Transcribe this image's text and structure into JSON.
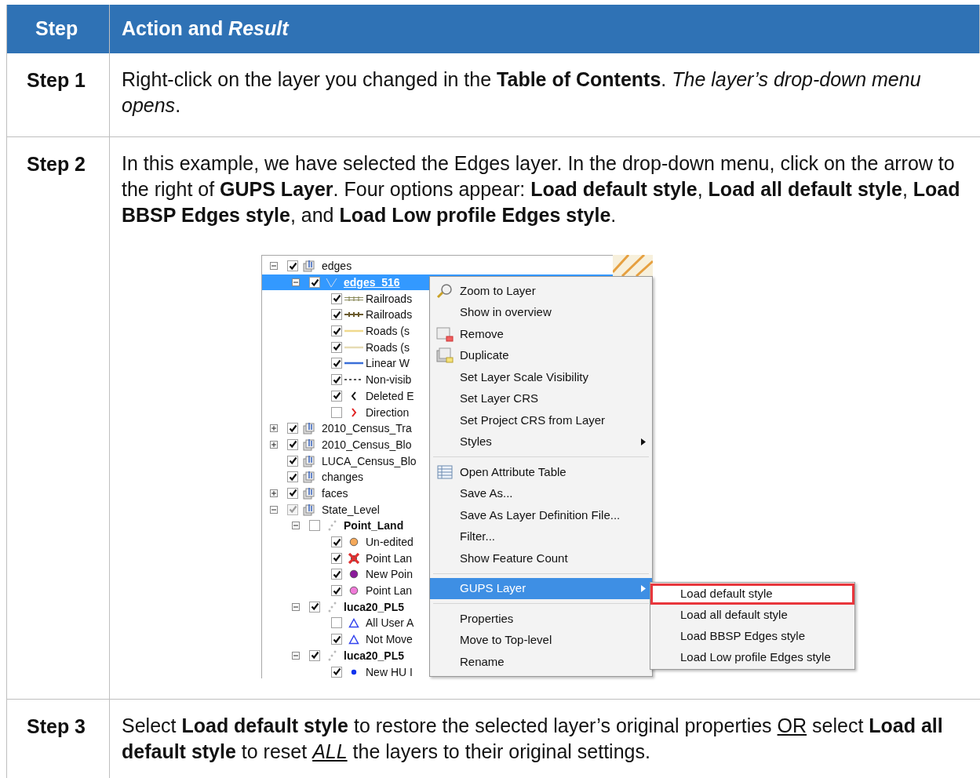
{
  "header": {
    "cells": [
      [
        {
          "text": "Step",
          "bold": true
        }
      ],
      [
        {
          "text": "Action and ",
          "bold": true
        },
        {
          "text": "Result",
          "bold": true,
          "italic": true
        }
      ]
    ]
  },
  "rows": [
    {
      "step": "Step 1",
      "text": [
        {
          "text": "Right-click on the layer you changed in the "
        },
        {
          "text": "Table of Contents",
          "bold": true
        },
        {
          "text": ". "
        },
        {
          "text": "The layer’s drop-down menu opens",
          "italic": true
        },
        {
          "text": "."
        }
      ]
    },
    {
      "step": "Step 2",
      "text": [
        {
          "text": "In this example, we have selected the Edges layer. In the drop-down menu, click on the arrow to the right of "
        },
        {
          "text": "GUPS Layer",
          "bold": true
        },
        {
          "text": ". Four options appear: "
        },
        {
          "text": "Load default style",
          "bold": true
        },
        {
          "text": ", "
        },
        {
          "text": "Load all default style",
          "bold": true
        },
        {
          "text": ", "
        },
        {
          "text": "Load BBSP Edges style",
          "bold": true
        },
        {
          "text": ", and "
        },
        {
          "text": "Load Low profile Edges style",
          "bold": true
        },
        {
          "text": "."
        }
      ],
      "screenshot": {
        "tree": [
          {
            "label": "edges",
            "kind": "group",
            "checked": true,
            "expanded": true,
            "selected": false,
            "children": [
              {
                "label": "edges_516",
                "kind": "line-layer",
                "checked": true,
                "expanded": true,
                "selected": true,
                "children": [
                  {
                    "label": "Railroads",
                    "kind": "double-line",
                    "color": "#8a8a5c",
                    "checked": true,
                    "selected": false
                  },
                  {
                    "label": "Railroads",
                    "kind": "tick-line",
                    "color": "#6b5b2e",
                    "checked": true,
                    "selected": false
                  },
                  {
                    "label": "Roads (s",
                    "kind": "line",
                    "color": "#f0d98c",
                    "checked": true,
                    "selected": false
                  },
                  {
                    "label": "Roads (s",
                    "kind": "line",
                    "color": "#e6dcb4",
                    "checked": true,
                    "selected": false
                  },
                  {
                    "label": "Linear W",
                    "kind": "line",
                    "color": "#3a6fd8",
                    "checked": true,
                    "selected": false
                  },
                  {
                    "label": "Non-visib",
                    "kind": "dashed",
                    "color": "#555555",
                    "checked": true,
                    "selected": false
                  },
                  {
                    "label": "Deleted E",
                    "kind": "chevron",
                    "color": "#111111",
                    "checked": true,
                    "selected": false
                  },
                  {
                    "label": "Direction",
                    "kind": "chevron",
                    "color": "#e02020",
                    "checked": false,
                    "selected": false
                  }
                ]
              }
            ]
          },
          {
            "label": "2010_Census_Tra",
            "kind": "group",
            "checked": true,
            "expanded": false,
            "selected": false
          },
          {
            "label": "2010_Census_Blo",
            "kind": "group",
            "checked": true,
            "expanded": false,
            "selected": false
          },
          {
            "label": "LUCA_Census_Blo",
            "kind": "group",
            "checked": true,
            "selected": false
          },
          {
            "label": "changes",
            "kind": "group",
            "checked": true,
            "selected": false
          },
          {
            "label": "faces",
            "kind": "group",
            "checked": true,
            "expanded": false,
            "selected": false
          },
          {
            "label": "State_Level",
            "kind": "group",
            "checked": true,
            "dimmed": true,
            "expanded": true,
            "selected": false,
            "children": [
              {
                "label": "Point_Land",
                "kind": "point-layer",
                "checked": false,
                "expanded": true,
                "bold": true,
                "selected": false,
                "children": [
                  {
                    "label": "Un-edited",
                    "kind": "circle",
                    "color": "#f5a95a",
                    "checked": true,
                    "selected": false
                  },
                  {
                    "label": "Point Lan",
                    "kind": "cross",
                    "color": "#e03030",
                    "checked": true,
                    "selected": false
                  },
                  {
                    "label": "New Poin",
                    "kind": "circle",
                    "color": "#8b1a9b",
                    "checked": true,
                    "selected": false
                  },
                  {
                    "label": "Point Lan",
                    "kind": "circle",
                    "color": "#f07ad8",
                    "checked": true,
                    "selected": false
                  }
                ]
              },
              {
                "label": "luca20_PL5",
                "kind": "point-layer",
                "checked": true,
                "expanded": true,
                "bold": true,
                "selected": false,
                "children": [
                  {
                    "label": "All User A",
                    "kind": "triangle",
                    "color": "#3344ee",
                    "checked": false,
                    "selected": false
                  },
                  {
                    "label": "Not Move",
                    "kind": "triangle",
                    "color": "#3344ee",
                    "checked": true,
                    "selected": false
                  }
                ]
              },
              {
                "label": "luca20_PL5",
                "kind": "point-layer",
                "checked": true,
                "expanded": true,
                "bold": true,
                "selected": false,
                "children": [
                  {
                    "label": "New HU I",
                    "kind": "dot",
                    "color": "#1133ee",
                    "checked": true,
                    "selected": false
                  }
                ]
              }
            ]
          }
        ],
        "menu": [
          {
            "kind": "zoom",
            "label": "Zoom to Layer",
            "selected": false
          },
          {
            "kind": "item",
            "label": "Show in overview",
            "selected": false
          },
          {
            "kind": "remove",
            "label": "Remove",
            "selected": false
          },
          {
            "kind": "duplicate",
            "label": "Duplicate",
            "selected": false
          },
          {
            "kind": "item",
            "label": "Set Layer Scale Visibility",
            "selected": false
          },
          {
            "kind": "item",
            "label": "Set Layer CRS",
            "selected": false
          },
          {
            "kind": "item",
            "label": "Set Project CRS from Layer",
            "selected": false
          },
          {
            "kind": "submenu",
            "label": "Styles",
            "selected": false
          },
          {
            "kind": "separator"
          },
          {
            "kind": "table",
            "label": "Open Attribute Table",
            "selected": false
          },
          {
            "kind": "item",
            "label": "Save As...",
            "selected": false
          },
          {
            "kind": "item",
            "label": "Save As Layer Definition File...",
            "selected": false
          },
          {
            "kind": "item",
            "label": "Filter...",
            "selected": false
          },
          {
            "kind": "item",
            "label": "Show Feature Count",
            "selected": false
          },
          {
            "kind": "separator"
          },
          {
            "kind": "submenu",
            "label": "GUPS Layer",
            "selected": true
          },
          {
            "kind": "separator"
          },
          {
            "kind": "item",
            "label": "Properties",
            "selected": false
          },
          {
            "kind": "item",
            "label": "Move to Top-level",
            "selected": false
          },
          {
            "kind": "item",
            "label": "Rename",
            "selected": false
          }
        ],
        "submenu": [
          {
            "label": "Load default style",
            "highlighted": true
          },
          {
            "label": "Load all default style",
            "highlighted": false
          },
          {
            "label": "Load BBSP Edges style",
            "highlighted": false
          },
          {
            "label": "Load Low profile Edges style",
            "highlighted": false
          }
        ]
      }
    },
    {
      "step": "Step 3",
      "text": [
        {
          "text": "Select "
        },
        {
          "text": "Load default style",
          "bold": true
        },
        {
          "text": " to restore the selected layer’s original properties "
        },
        {
          "text": "OR",
          "underline": true
        },
        {
          "text": " select "
        },
        {
          "text": "Load all default style",
          "bold": true
        },
        {
          "text": " to reset "
        },
        {
          "text": "ALL",
          "italic": true,
          "underline": true
        },
        {
          "text": " the layers to their original settings."
        }
      ]
    }
  ]
}
